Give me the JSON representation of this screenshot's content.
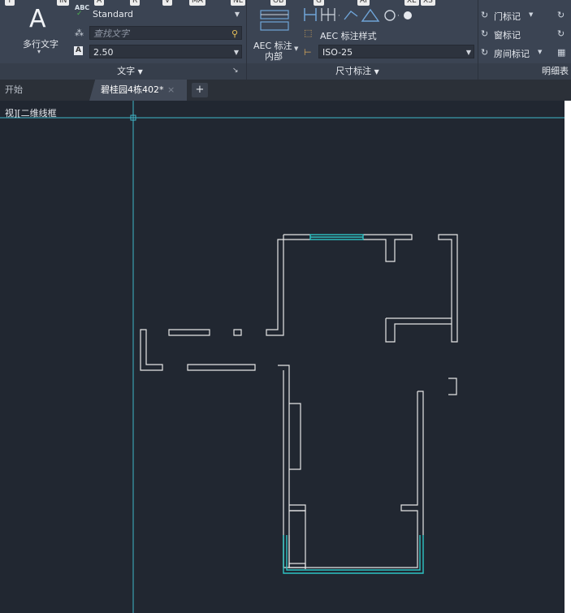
{
  "ribbon": {
    "panel_text": {
      "big_letter": "A",
      "mtext_label": "多行文字",
      "style_value": "Standard",
      "find_placeholder": "查找文字",
      "height_value": "2.50",
      "panel_title": "文字"
    },
    "panel_dimension": {
      "aec_label_line1": "AEC 标注",
      "aec_label_line2": "内部",
      "aec_style_label": "AEC 标注样式",
      "dim_style_value": "ISO-25",
      "panel_title": "尺寸标注"
    },
    "panel_mark": {
      "door_label": "门标记",
      "window_label": "窗标记",
      "room_label": "房间标记",
      "panel_title": "明细表"
    },
    "shortcut_keys": [
      "IN",
      "T",
      "ABC",
      "A",
      "R",
      "V",
      "MA",
      "NE",
      "OB",
      "G",
      "AI",
      "XE",
      "XS"
    ]
  },
  "tabs": {
    "start_label": "开始",
    "active_label": "碧桂园4栋402*",
    "close_glyph": "×",
    "add_glyph": "+"
  },
  "viewport": {
    "label": "视][二维线框"
  },
  "colors": {
    "wall": "#e6e6e6",
    "window": "#2ec4c4",
    "crosshair": "#3fb7c9",
    "background": "#212731"
  }
}
